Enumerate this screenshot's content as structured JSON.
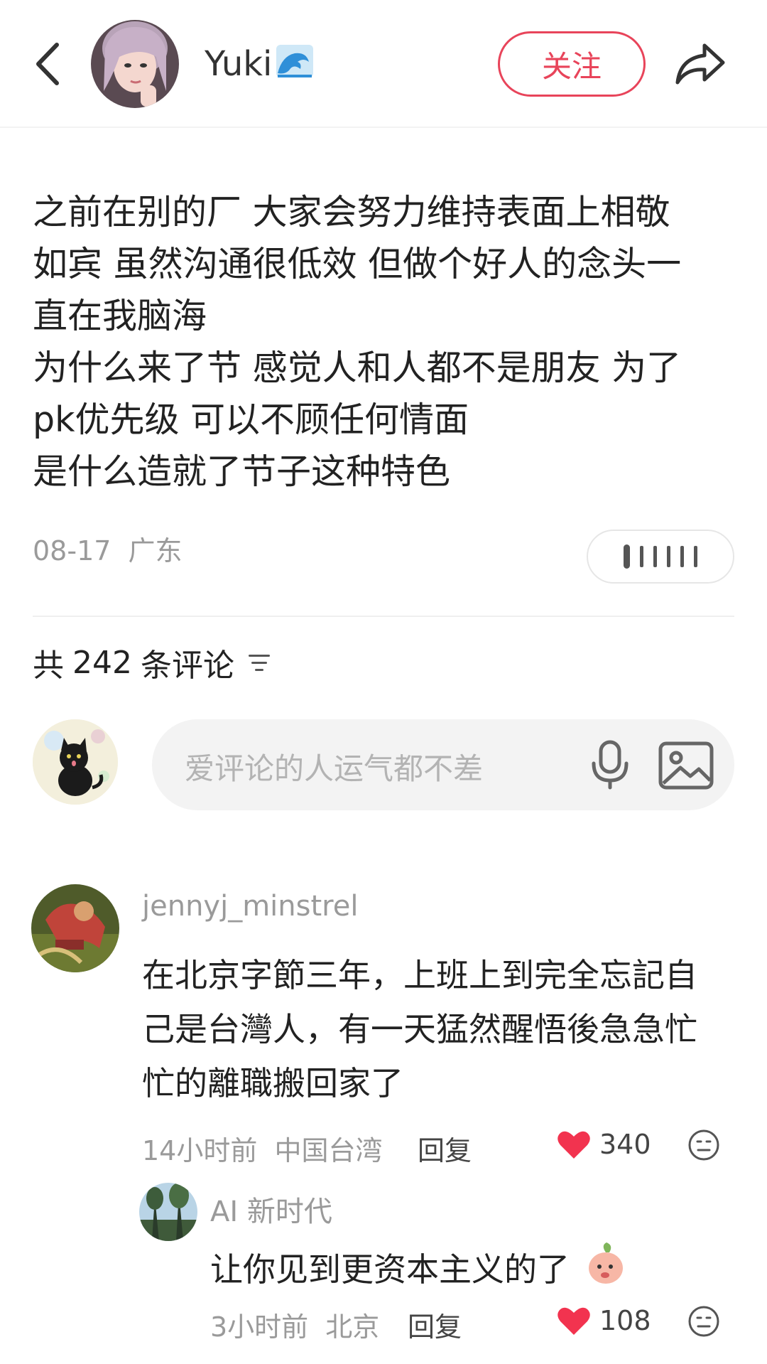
{
  "header": {
    "author_name": "Yuki",
    "follow_label": "关注"
  },
  "post": {
    "text": "之前在别的厂 大家会努力维持表面上相敬\n如宾 虽然沟通很低效 但做个好人的念头一\n直在我脑海\n为什么来了节 感觉人和人都不是朋友 为了\npk优先级 可以不顾任何情面\n是什么造就了节子这种特色",
    "date": "08-17",
    "location": "广东"
  },
  "comments_section": {
    "count_prefix": "共",
    "count": "242",
    "count_suffix": "条评论",
    "input_placeholder": "爱评论的人运气都不差"
  },
  "comments": [
    {
      "username": "jennyj_minstrel",
      "text": "在北京字節三年，上班上到完全忘記自\n己是台灣人，有一天猛然醒悟後急急忙\n忙的離職搬回家了",
      "time": "14小时前",
      "location": "中国台湾",
      "reply_label": "回复",
      "likes": "340"
    },
    {
      "username": "AI 新时代",
      "text": "让你见到更资本主义的了",
      "time": "3小时前",
      "location": "北京",
      "reply_label": "回复",
      "likes": "108"
    }
  ],
  "colors": {
    "accent": "#e8445a",
    "like_heart": "#f2334f",
    "muted_text": "#9a9a9a"
  },
  "icons": [
    "back-arrow-icon",
    "wave-emoji-icon",
    "share-icon",
    "waveform-icon",
    "sort-icon",
    "microphone-icon",
    "image-icon",
    "heart-icon",
    "face-emoji-icon",
    "peach-emoji-icon"
  ]
}
